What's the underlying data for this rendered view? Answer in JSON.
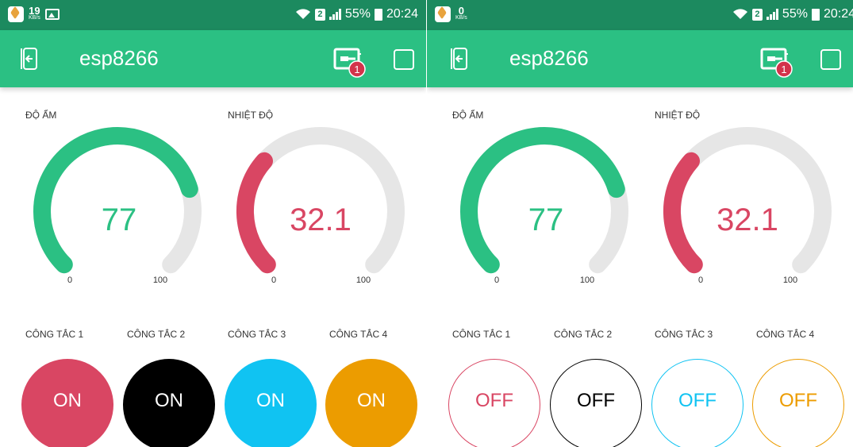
{
  "colors": {
    "status_bar": "#1c8a5f",
    "app_bar": "#2bc083",
    "humidity": "#2bc083",
    "temperature": "#d94663",
    "track": "#e6e6e6",
    "switch1": "#d94663",
    "switch2": "#000000",
    "switch3": "#10c3f2",
    "switch4": "#ec9c00"
  },
  "screens": [
    {
      "status_bar": {
        "speed_value": "19",
        "speed_unit": "KB/s",
        "sim": "2",
        "battery": "55%",
        "time": "20:24",
        "icons": [
          "vpn-icon",
          "image-icon",
          "wifi-icon",
          "signal-icon",
          "battery-icon"
        ]
      },
      "app_bar": {
        "title": "esp8266",
        "badge": "1",
        "icons": [
          "back-icon",
          "device-icon",
          "square-icon"
        ]
      },
      "gauges": [
        {
          "label": "ĐỘ ẨM",
          "value": "77",
          "fraction": 0.77,
          "min": "0",
          "max": "100",
          "color": "#2bc083"
        },
        {
          "label": "NHIỆT ĐỘ",
          "value": "32.1",
          "fraction": 0.321,
          "min": "0",
          "max": "100",
          "color": "#d94663"
        }
      ],
      "switches": [
        {
          "label": "CÔNG TẮC 1",
          "state": "ON",
          "color": "#d94663"
        },
        {
          "label": "CÔNG TẮC 2",
          "state": "ON",
          "color": "#000000"
        },
        {
          "label": "CÔNG TẮC 3",
          "state": "ON",
          "color": "#10c3f2"
        },
        {
          "label": "CÔNG TẮC 4",
          "state": "ON",
          "color": "#ec9c00"
        }
      ]
    },
    {
      "status_bar": {
        "speed_value": "0",
        "speed_unit": "KB/s",
        "sim": "2",
        "battery": "55%",
        "time": "20:24",
        "icons": [
          "vpn-icon",
          "wifi-icon",
          "signal-icon",
          "battery-icon"
        ]
      },
      "app_bar": {
        "title": "esp8266",
        "badge": "1",
        "icons": [
          "back-icon",
          "device-icon",
          "square-icon"
        ]
      },
      "gauges": [
        {
          "label": "ĐỘ ẨM",
          "value": "77",
          "fraction": 0.77,
          "min": "0",
          "max": "100",
          "color": "#2bc083"
        },
        {
          "label": "NHIỆT ĐỘ",
          "value": "32.1",
          "fraction": 0.321,
          "min": "0",
          "max": "100",
          "color": "#d94663"
        }
      ],
      "switches": [
        {
          "label": "CÔNG TẮC 1",
          "state": "OFF",
          "color": "#d94663"
        },
        {
          "label": "CÔNG TẮC 2",
          "state": "OFF",
          "color": "#000000"
        },
        {
          "label": "CÔNG TẮC 3",
          "state": "OFF",
          "color": "#10c3f2"
        },
        {
          "label": "CÔNG TẮC 4",
          "state": "OFF",
          "color": "#ec9c00"
        }
      ]
    }
  ]
}
